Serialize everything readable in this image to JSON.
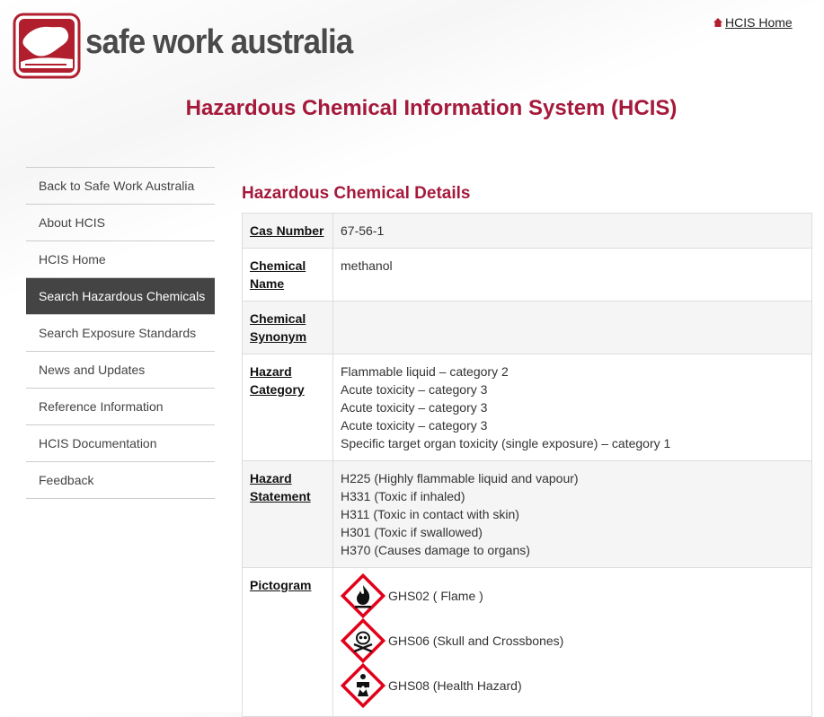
{
  "header": {
    "brand": "safe work australia",
    "home_link": "HCIS Home",
    "site_title": "Hazardous Chemical Information System (HCIS)"
  },
  "sidebar": {
    "items": [
      {
        "label": "Back to Safe Work Australia"
      },
      {
        "label": "About HCIS"
      },
      {
        "label": "HCIS Home"
      },
      {
        "label": "Search Hazardous Chemicals",
        "active": true
      },
      {
        "label": "Search Exposure Standards"
      },
      {
        "label": "News and Updates"
      },
      {
        "label": "Reference Information"
      },
      {
        "label": "HCIS Documentation"
      },
      {
        "label": "Feedback"
      }
    ]
  },
  "main": {
    "section_title": "Hazardous Chemical Details",
    "cas_label": "Cas Number",
    "cas_value": "67-56-1",
    "name_label_1": "Chemical",
    "name_label_2": "Name",
    "name_value": "methanol",
    "synonym_label_1": "Chemical",
    "synonym_label_2": "Synonym",
    "synonym_value": "",
    "category_label_1": "Hazard",
    "category_label_2": "Category",
    "categories": [
      "Flammable liquid – category 2",
      "Acute toxicity – category 3",
      "Acute toxicity – category 3",
      "Acute toxicity – category 3",
      "Specific target organ toxicity (single exposure) – category 1"
    ],
    "statement_label_1": "Hazard",
    "statement_label_2": "Statement",
    "statements": [
      "H225 (Highly flammable liquid and vapour)",
      "H331 (Toxic if inhaled)",
      "H311 (Toxic in contact with skin)",
      "H301 (Toxic if swallowed)",
      "H370 (Causes damage to organs)"
    ],
    "pictogram_label": "Pictogram",
    "pictograms": [
      {
        "label": "GHS02 ( Flame )",
        "icon": "flame-pictogram-icon"
      },
      {
        "label": "GHS06 (Skull and Crossbones)",
        "icon": "skull-crossbones-pictogram-icon"
      },
      {
        "label": "GHS08 (Health Hazard)",
        "icon": "health-hazard-pictogram-icon"
      }
    ]
  },
  "colors": {
    "accent": "#a5193b",
    "active_nav": "#444444"
  }
}
